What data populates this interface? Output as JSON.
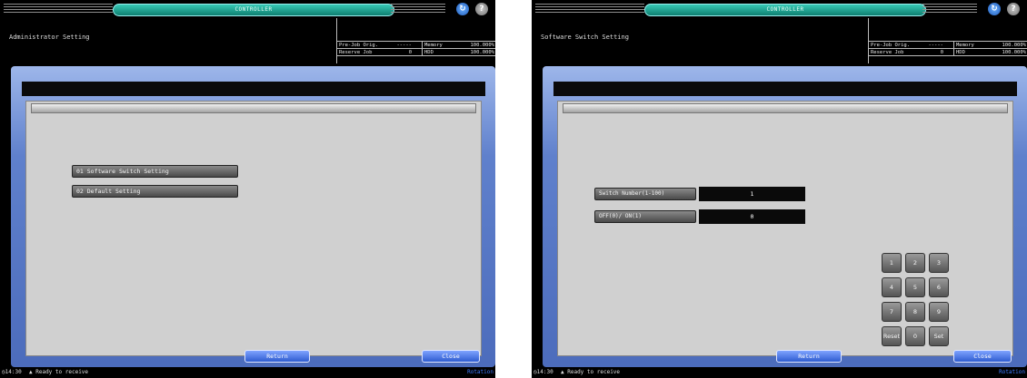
{
  "left": {
    "controller_label": "CONTROLLER",
    "screen_title": "Administrator Setting",
    "status": {
      "pre_job_label": "Pre-Job Orig.",
      "pre_job_value": "-----",
      "memory_label": "Memory",
      "memory_value": "100.000%",
      "reserve_label": "Reserve Job",
      "reserve_value": "0",
      "hdd_label": "HDD",
      "hdd_value": "100.000%"
    },
    "menu": [
      "01 Software Switch Setting",
      "02 Default Setting"
    ],
    "return_label": "Return",
    "close_label": "Close",
    "clock": "14:30",
    "status_text": "Ready to receive",
    "rotation_label": "Rotation"
  },
  "right": {
    "controller_label": "CONTROLLER",
    "screen_title": "Software Switch Setting",
    "status": {
      "pre_job_label": "Pre-Job Orig.",
      "pre_job_value": "-----",
      "memory_label": "Memory",
      "memory_value": "100.000%",
      "reserve_label": "Reserve Job",
      "reserve_value": "0",
      "hdd_label": "HDD",
      "hdd_value": "100.000%"
    },
    "switch_number_label": "Switch Number(1-100)",
    "switch_number_value": "1",
    "off_on_label": "OFF(0)/ ON(1)",
    "off_on_value": "0",
    "keypad": [
      "1",
      "2",
      "3",
      "4",
      "5",
      "6",
      "7",
      "8",
      "9",
      "Reset",
      "0",
      "Set"
    ],
    "return_label": "Return",
    "close_label": "Close",
    "clock": "14:30",
    "status_text": "Ready to receive",
    "rotation_label": "Rotation"
  },
  "icons": {
    "rotate": "rotate-screen-icon",
    "help": "help-icon",
    "clock": "clock-icon",
    "status": "printer-icon"
  }
}
